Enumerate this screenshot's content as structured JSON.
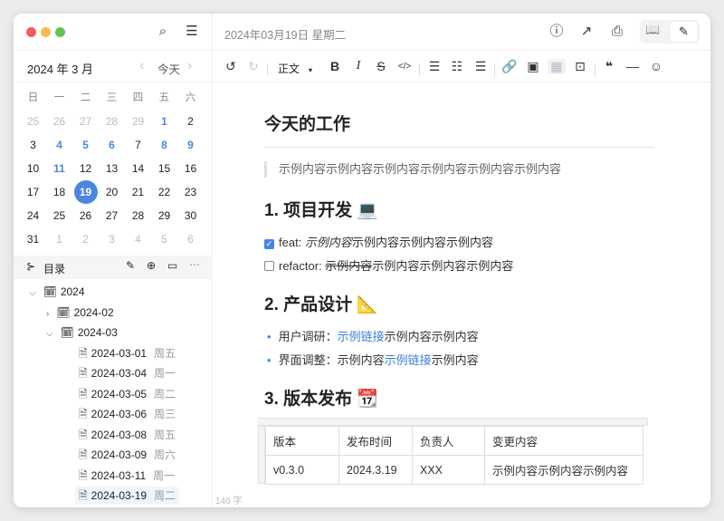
{
  "window": {
    "traffic_colors": [
      "#ee5f57",
      "#f5bd4f",
      "#5fc454"
    ]
  },
  "calendar": {
    "title": "2024 年 3 月",
    "today_label": "今天",
    "prev": "‹",
    "next": "›",
    "weekdays": [
      "日",
      "一",
      "二",
      "三",
      "四",
      "五",
      "六"
    ],
    "weeks": [
      [
        "25",
        "26",
        "27",
        "28",
        "29",
        "1",
        "2"
      ],
      [
        "3",
        "4",
        "5",
        "6",
        "7",
        "8",
        "9"
      ],
      [
        "10",
        "11",
        "12",
        "13",
        "14",
        "15",
        "16"
      ],
      [
        "17",
        "18",
        "19",
        "20",
        "21",
        "22",
        "23"
      ],
      [
        "24",
        "25",
        "26",
        "27",
        "28",
        "29",
        "30"
      ],
      [
        "31",
        "1",
        "2",
        "3",
        "4",
        "5",
        "6"
      ]
    ],
    "selected": "19",
    "days_with_notes": [
      "1",
      "4",
      "5",
      "6",
      "8",
      "9",
      "11"
    ],
    "accent": "#4a86e0"
  },
  "outline": {
    "label": "目录"
  },
  "tree": [
    {
      "label": "2024",
      "level": 0,
      "type": "folder",
      "expanded": true
    },
    {
      "label": "2024-02",
      "level": 1,
      "type": "folder",
      "expanded": false
    },
    {
      "label": "2024-03",
      "level": 1,
      "type": "folder",
      "expanded": true
    },
    {
      "label": "2024-03-01",
      "week": "周五",
      "level": 2,
      "type": "file"
    },
    {
      "label": "2024-03-04",
      "week": "周一",
      "level": 2,
      "type": "file"
    },
    {
      "label": "2024-03-05",
      "week": "周二",
      "level": 2,
      "type": "file"
    },
    {
      "label": "2024-03-06",
      "week": "周三",
      "level": 2,
      "type": "file"
    },
    {
      "label": "2024-03-08",
      "week": "周五",
      "level": 2,
      "type": "file"
    },
    {
      "label": "2024-03-09",
      "week": "周六",
      "level": 2,
      "type": "file"
    },
    {
      "label": "2024-03-11",
      "week": "周一",
      "level": 2,
      "type": "file"
    },
    {
      "label": "2024-03-19",
      "week": "周二",
      "level": 2,
      "type": "file",
      "selected": true
    }
  ],
  "header": {
    "date": "2024年03月19日 星期二"
  },
  "toolbar": {
    "style_select": "正文"
  },
  "doc": {
    "title": "今天的工作",
    "quote": "示例内容示例内容示例内容示例内容示例内容示例内容",
    "h_dev": "1. 项目开发 💻",
    "task1_prefix": "feat: ",
    "task1_italic": "示例内容",
    "task1_rest": "示例内容示例内容示例内容",
    "task2_prefix": "refactor: ",
    "task2_strike": "示例内容",
    "task2_rest": "示例内容示例内容示例内容",
    "h_design": "2. 产品设计 📐",
    "b1_label": "用户调研：",
    "b1_link": "示例链接",
    "b1_rest": "示例内容示例内容",
    "b2_label": "界面调整：示例内容",
    "b2_link": "示例链接",
    "b2_rest": "示例内容",
    "h_release": "3. 版本发布 📆",
    "table": {
      "headers": [
        "版本",
        "发布时间",
        "负责人",
        "变更内容"
      ],
      "rows": [
        [
          "v0.3.0",
          "2024.3.19",
          "XXX",
          "示例内容示例内容示例内容"
        ]
      ]
    }
  },
  "status": {
    "word_count": "146 字"
  }
}
